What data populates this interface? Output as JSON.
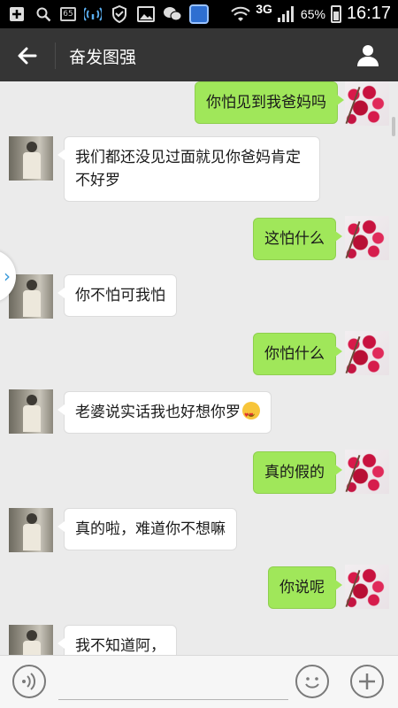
{
  "status_bar": {
    "network_badge": "65",
    "network_type": "3G",
    "battery_percent": "65%",
    "time": "16:17",
    "icons": [
      "add-square-icon",
      "search-icon",
      "sim-icon",
      "wifi-signal-icon",
      "shield-icon",
      "gallery-icon",
      "wechat-icon",
      "browser-icon",
      "wifi-icon",
      "cell-signal-icon",
      "battery-icon"
    ]
  },
  "header": {
    "title": "奋发图强",
    "back_icon": "arrow-left-icon",
    "profile_icon": "person-icon",
    "background": "#353535"
  },
  "messages": [
    {
      "side": "me",
      "text": "你怕见到我爸妈吗"
    },
    {
      "side": "other",
      "text": "我们都还没见过面就见你爸妈肯定不好罗"
    },
    {
      "side": "me",
      "text": "这怕什么"
    },
    {
      "side": "other",
      "text": "你不怕可我怕"
    },
    {
      "side": "me",
      "text": "你怕什么"
    },
    {
      "side": "other",
      "text": "老婆说实话我也好想你罗",
      "emoji": "heart-eyes-emoji-icon"
    },
    {
      "side": "me",
      "text": "真的假的"
    },
    {
      "side": "other",
      "text": "真的啦，难道你不想嘛"
    },
    {
      "side": "me",
      "text": "你说呢"
    },
    {
      "side": "other",
      "text": "我不知道阿，"
    }
  ],
  "input_bar": {
    "voice_icon": "voice-icon",
    "emoji_icon": "smiley-icon",
    "plus_icon": "plus-icon"
  },
  "colors": {
    "my_bubble": "#a0e75a",
    "other_bubble": "#ffffff",
    "chat_background": "#ebebeb"
  }
}
